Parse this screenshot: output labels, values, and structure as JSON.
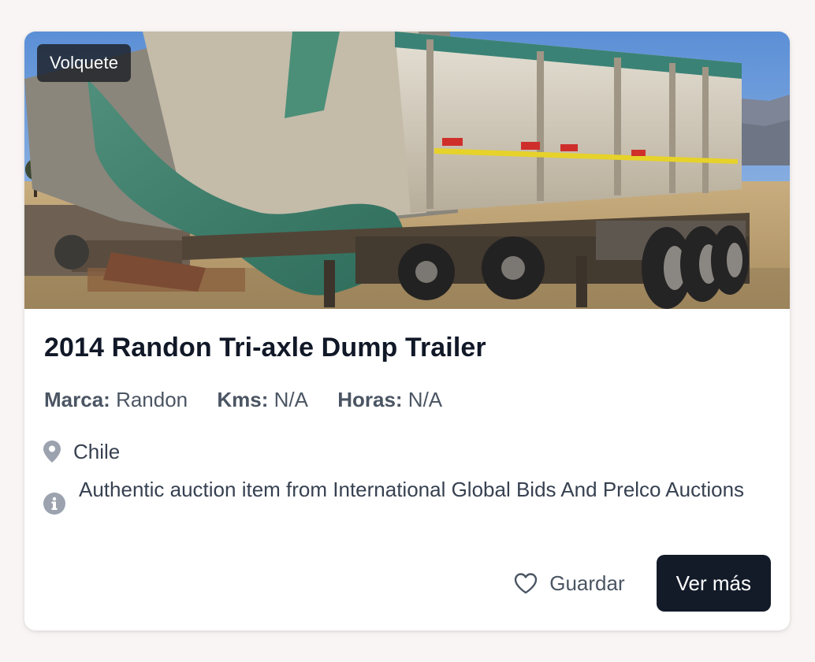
{
  "listing": {
    "category_badge": "Volquete",
    "title": "2014 Randon Tri-axle Dump Trailer",
    "specs": {
      "brand_label": "Marca:",
      "brand_value": "Randon",
      "kms_label": "Kms:",
      "kms_value": "N/A",
      "hours_label": "Horas:",
      "hours_value": "N/A"
    },
    "location": "Chile",
    "note": "Authentic auction item from International Global Bids And Prelco Auctions",
    "location_icon": "map-pin-icon",
    "info_icon": "info-circle-icon"
  },
  "actions": {
    "save_label": "Guardar",
    "save_icon": "heart-icon",
    "more_label": "Ver más"
  },
  "colors": {
    "page_background": "#f9f5f4",
    "card_background": "#ffffff",
    "primary_button": "#131b29",
    "title_text": "#111827",
    "secondary_text": "#4b5563",
    "icon_gray": "#9ca3af"
  }
}
